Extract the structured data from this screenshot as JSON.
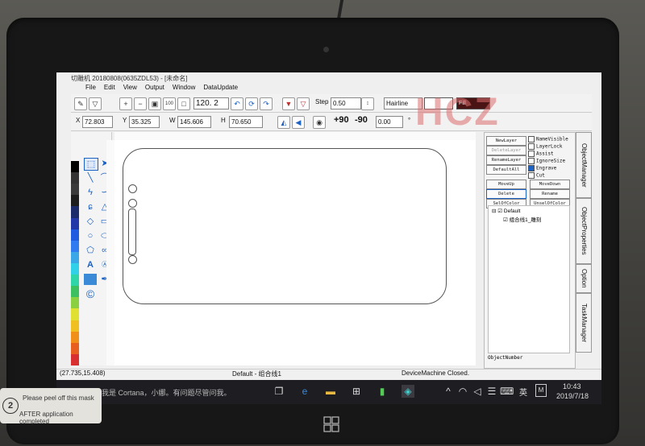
{
  "window": {
    "title": "切雕机 20180808(0635ZDL53) - [未命名]",
    "menu": [
      "File",
      "Edit",
      "View",
      "Output",
      "Window",
      "DataUpdate"
    ]
  },
  "toolbar1": {
    "zoom_value": "120. 2",
    "step_label": "Step",
    "step_value": "0.50",
    "line_style": "Hairline",
    "fill_label": "Fill"
  },
  "toolbar2": {
    "x_label": "X",
    "x_value": "72.803",
    "y_label": "Y",
    "y_value": "35.325",
    "w_label": "W",
    "w_value": "145.606",
    "h_label": "H",
    "h_value": "70.650",
    "rot_plus": "+90",
    "rot_minus": "-90",
    "angle_value": "0.00",
    "deg_symbol": "°"
  },
  "object_panel": {
    "buttons": [
      "NewLayer",
      "DeleteLayer",
      "RenameLayer",
      "DefaultAll",
      "MoveUp",
      "MoveDown",
      "Delete",
      "Rename",
      "SelOfColor",
      "UnselOfColor"
    ],
    "checks": [
      {
        "label": "NameVisible",
        "checked": false
      },
      {
        "label": "LayerLock",
        "checked": false
      },
      {
        "label": "Assist",
        "checked": false
      },
      {
        "label": "IgnoreSize",
        "checked": false
      },
      {
        "label": "Engrave",
        "checked": true
      },
      {
        "label": "Cut",
        "checked": false
      }
    ],
    "tree_root": "Default",
    "tree_child": "组合线1_雕刻",
    "footer_label": "ObjectNumber"
  },
  "side_tabs": [
    "ObjectManager",
    "ObjectProperties",
    "Option",
    "TaskManager"
  ],
  "status": {
    "coords": "(27.735,15.408)",
    "layer": "Default - 组合线1",
    "device": "DeviceMachine Closed."
  },
  "taskbar": {
    "cortana": "我是 Cortana，小娜。有问题尽管问我。",
    "ime": "英",
    "time": "10:43",
    "date": "2019/7/18"
  },
  "overlay": {
    "watermark": "HCZ"
  },
  "sticker": {
    "number": "2",
    "line1": "Please peel off this mask",
    "line2": "AFTER application completed"
  },
  "colors": {
    "palette": [
      "#000000",
      "#333333",
      "#3b3b3b",
      "#1d1d1d",
      "#1a2a6a",
      "#2238a8",
      "#1f5be0",
      "#2f7cf0",
      "#3aa7e6",
      "#2fd0e8",
      "#2ed5a8",
      "#3cc060",
      "#8ad040",
      "#e0e030",
      "#f0c020",
      "#f09018",
      "#e86020",
      "#d83030"
    ],
    "accent": "#1c62c4",
    "watermark": "#dc6e6e"
  }
}
